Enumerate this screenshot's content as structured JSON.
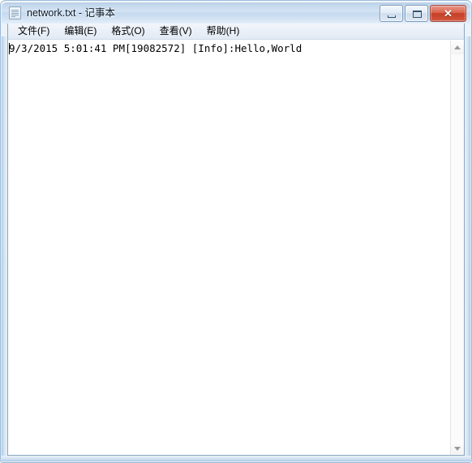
{
  "window": {
    "title": "network.txt - 记事本",
    "icon": "notepad-document-icon"
  },
  "caption_buttons": {
    "minimize_label": "",
    "maximize_label": "",
    "close_label": "✕"
  },
  "menu": {
    "items": [
      {
        "label": "文件(F)",
        "name": "menu-file"
      },
      {
        "label": "编辑(E)",
        "name": "menu-edit"
      },
      {
        "label": "格式(O)",
        "name": "menu-format"
      },
      {
        "label": "查看(V)",
        "name": "menu-view"
      },
      {
        "label": "帮助(H)",
        "name": "menu-help"
      }
    ]
  },
  "document": {
    "lines": [
      "9/3/2015 5:01:41 PM[19082572] [Info]:Hello,World"
    ],
    "text": "9/3/2015 5:01:41 PM[19082572] [Info]:Hello,World"
  },
  "scrollbar": {
    "up_arrow": "scroll-up-icon",
    "down_arrow": "scroll-down-icon"
  },
  "colors": {
    "title_bar_top": "#b4cbe4",
    "title_bar_bottom": "#e4eefa",
    "close_button": "#c43f28",
    "client_background": "#ffffff",
    "menu_bar": "#eaf0f8",
    "frame_border": "#9dbbd8"
  }
}
